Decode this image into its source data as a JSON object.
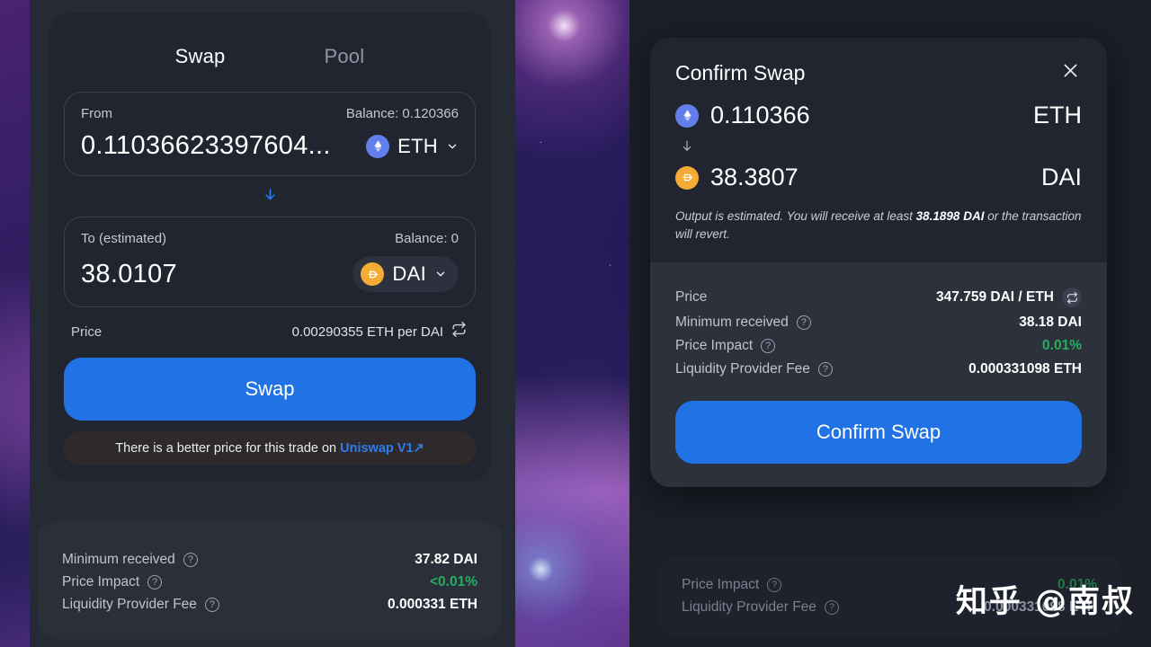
{
  "left_panel": {
    "tabs": [
      {
        "label": "Swap",
        "active": true
      },
      {
        "label": "Pool",
        "active": false
      }
    ],
    "from": {
      "label": "From",
      "balance": "Balance: 0.120366",
      "amount": "0.11036623397604...",
      "token": "ETH",
      "token_icon": "ethereum-icon"
    },
    "to": {
      "label": "To (estimated)",
      "balance": "Balance: 0",
      "amount": "38.0107",
      "token": "DAI",
      "token_icon": "dai-icon"
    },
    "price": {
      "label": "Price",
      "value": "0.00290355 ETH per DAI",
      "toggle_icon": "swap-direction-icon"
    },
    "swap_button": "Swap",
    "better_price": {
      "text": "There is a better price for this trade on ",
      "link": "Uniswap V1",
      "arrow": "↗"
    },
    "details": [
      {
        "label": "Minimum received",
        "value": "37.82 DAI",
        "green": false
      },
      {
        "label": "Price Impact",
        "value": "<0.01%",
        "green": true
      },
      {
        "label": "Liquidity Provider Fee",
        "value": "0.000331 ETH",
        "green": false
      }
    ]
  },
  "right_panel": {
    "background_details": [
      {
        "label": "Price Impact",
        "value": "0.01%",
        "green": true
      },
      {
        "label": "Liquidity Provider Fee",
        "value": "0.000331098 ETH",
        "green": false
      }
    ],
    "modal": {
      "title": "Confirm Swap",
      "close_icon": "close-icon",
      "from": {
        "amount": "0.110366",
        "symbol": "ETH",
        "icon": "ethereum-icon"
      },
      "arrow_icon": "arrow-down-icon",
      "to": {
        "amount": "38.3807",
        "symbol": "DAI",
        "icon": "dai-icon"
      },
      "note_prefix": "Output is estimated. You will receive at least ",
      "note_bold": "38.1898 DAI",
      "note_suffix": " or the transaction will revert.",
      "details": [
        {
          "label": "Price",
          "value": "347.759 DAI / ETH",
          "green": false,
          "has_help": false,
          "has_toggle": true
        },
        {
          "label": "Minimum received",
          "value": "38.18 DAI",
          "green": false,
          "has_help": true,
          "has_toggle": false
        },
        {
          "label": "Price Impact",
          "value": "0.01%",
          "green": true,
          "has_help": true,
          "has_toggle": false
        },
        {
          "label": "Liquidity Provider Fee",
          "value": "0.000331098 ETH",
          "green": false,
          "has_help": true,
          "has_toggle": false
        }
      ],
      "confirm_button": "Confirm Swap"
    }
  },
  "watermark": "知乎 @南叔",
  "colors": {
    "accent_blue": "#2172e5",
    "link_blue": "#2d7bf0",
    "green": "#27ae60",
    "eth_badge": "#627eea",
    "dai_badge": "#f5ac37",
    "card_bg": "#212530",
    "panel_bg": "#252a35",
    "details_bg": "#2a2f3a"
  }
}
